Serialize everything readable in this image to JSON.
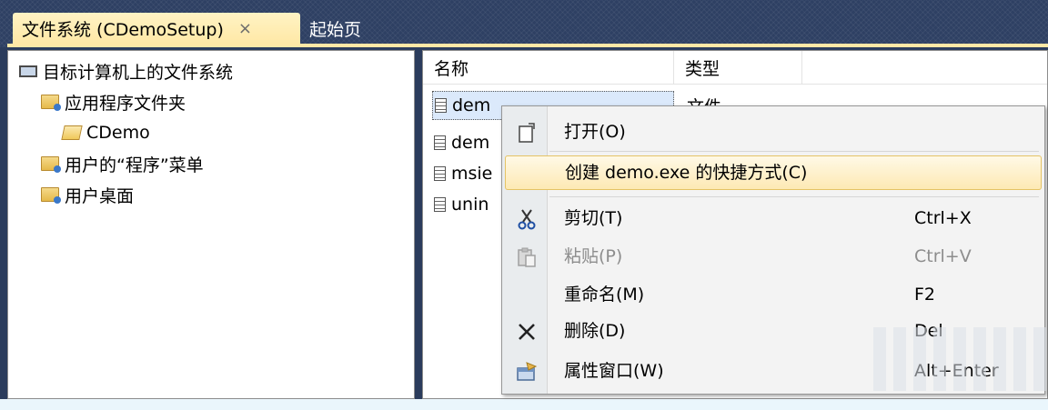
{
  "tabs": {
    "active_label": "文件系统 (CDemoSetup)",
    "close_glyph": "×",
    "inactive_label": "起始页"
  },
  "tree": {
    "root": "目标计算机上的文件系统",
    "items": [
      {
        "label": "应用程序文件夹",
        "icon": "folder-closed-icon"
      },
      {
        "label": "CDemo",
        "icon": "folder-open-icon"
      },
      {
        "label": "用户的“程序”菜单",
        "icon": "folder-closed-icon"
      },
      {
        "label": "用户桌面",
        "icon": "folder-closed-icon"
      }
    ]
  },
  "file_list": {
    "columns": [
      "名称",
      "类型"
    ],
    "rows": [
      {
        "name": "dem",
        "type": "文件"
      },
      {
        "name": "dem"
      },
      {
        "name": "msie"
      },
      {
        "name": "unin"
      }
    ]
  },
  "context_menu": {
    "items": [
      {
        "label": "打开(O)",
        "shortcut": "",
        "icon": "open-file-icon"
      },
      {
        "label": "创建 demo.exe 的快捷方式(C)",
        "shortcut": "",
        "icon": ""
      },
      {
        "label": "剪切(T)",
        "shortcut": "Ctrl+X",
        "icon": "scissors-icon"
      },
      {
        "label": "粘贴(P)",
        "shortcut": "Ctrl+V",
        "icon": "paste-icon"
      },
      {
        "label": "重命名(M)",
        "shortcut": "F2",
        "icon": ""
      },
      {
        "label": "删除(D)",
        "shortcut": "Del",
        "icon": "delete-x-icon"
      },
      {
        "label": "属性窗口(W)",
        "shortcut": "Alt+Enter",
        "icon": "properties-icon"
      }
    ]
  },
  "colors": {
    "frame_bg": "#2b3c5c",
    "active_tab": "#ffe8a6",
    "menu_highlight": "#fde9b4"
  }
}
